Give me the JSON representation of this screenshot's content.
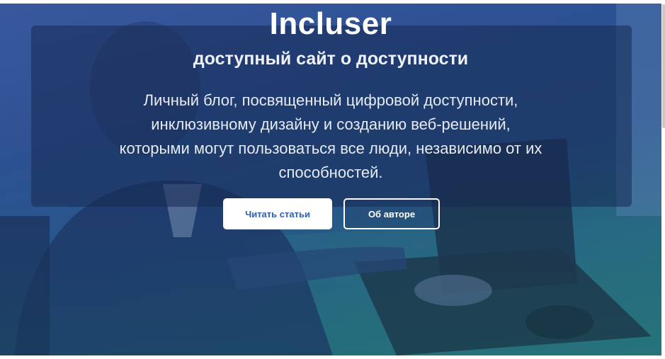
{
  "hero": {
    "title": "Incluser",
    "subtitle": "доступный сайт о доступности",
    "description_lines": [
      "Личный блог, посвященный цифровой доступности,",
      "инклюзивному дизайну и созданию веб-решений,",
      "которыми могут пользоваться все люди, независимо от их",
      "способностей."
    ],
    "background_image": "person-at-laptop-photo"
  },
  "actions": {
    "read_articles_label": "Читать статьи",
    "about_author_label": "Об авторе"
  },
  "colors": {
    "gradient_top": "#3f5fa5",
    "gradient_bottom": "#2a8c78",
    "panel": "#162a52",
    "primary_button_text": "#2b5fb3"
  }
}
